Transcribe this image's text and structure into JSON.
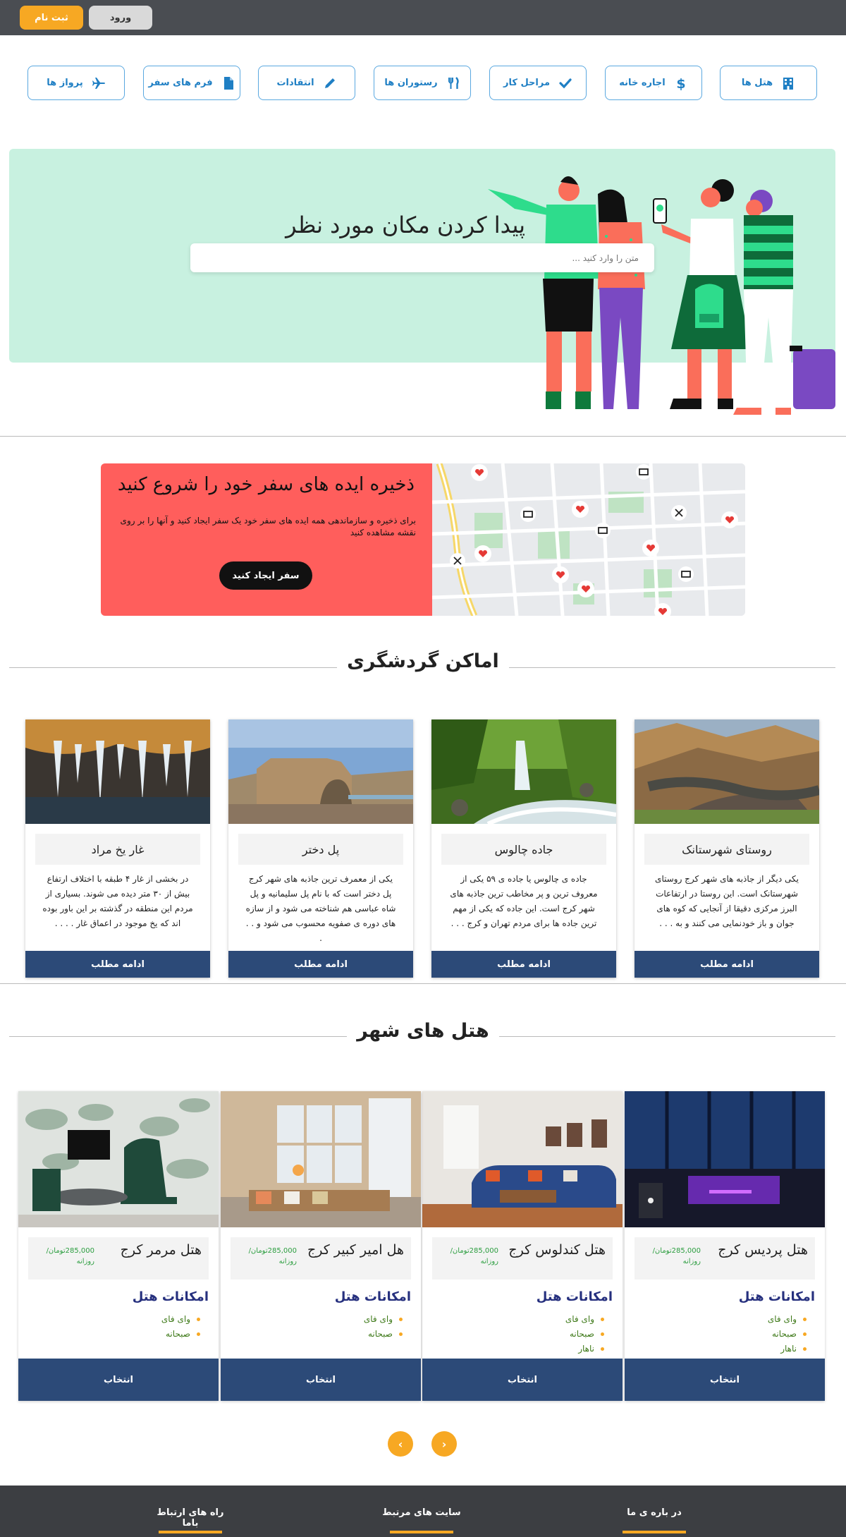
{
  "topbar": {
    "signup_label": "ثبت نام",
    "login_label": "ورود"
  },
  "categories": [
    {
      "label": "هتل ها",
      "icon": "building-icon"
    },
    {
      "label": "اجاره خانه",
      "icon": "dollar-icon"
    },
    {
      "label": "مراحل کار",
      "icon": "check-icon"
    },
    {
      "label": "رستوران ها",
      "icon": "utensils-icon"
    },
    {
      "label": "انتقادات",
      "icon": "pencil-icon"
    },
    {
      "label": "فرم های سفر",
      "icon": "file-icon"
    },
    {
      "label": "پرواز ها",
      "icon": "plane-icon"
    }
  ],
  "hero": {
    "title": "پیدا کردن مکان مورد نظر",
    "search_placeholder": "متن را وارد کنید ..."
  },
  "ideas": {
    "title": "ذخیره ایده های سفر خود را شروع کنید",
    "description": "برای ذخیره و سازماندهی همه ایده های سفر خود یک سفر ایجاد کنید و آنها را بر روی نقشه مشاهده کنید",
    "button_label": "سفر ایجاد کنید"
  },
  "places_section": {
    "title": "اماکن گردشگری"
  },
  "places": [
    {
      "name": "روستای شهرستانک",
      "description": "یکی دیگر از جاذبه های شهر کرج روستای شهرستانک است. این روستا در ارتفاعات البرز مرکزی دقیقا از آنجایی که کوه های جوان و باز خودنمایی می کنند و به . . .",
      "button_label": "ادامه مطلب"
    },
    {
      "name": "جاده چالوس",
      "description": "جاده ی چالوس یا جاده ی ۵۹ یکی از معروف ترین و پر مخاطب ترین جاذبه های شهر کرج است. این جاده که یکی از مهم ترین جاده ها برای مردم تهران و کرج . . .",
      "button_label": "ادامه مطلب"
    },
    {
      "name": "پل دختر",
      "description": "یکی از معمرف ترین جاذبه های شهر کرج پل دختر است که با نام پل سلیمانیه و پل شاه عباسی هم شناخته می شود و از سازه های دوره ی صفویه محسوب می شود و . . .",
      "button_label": "ادامه مطلب"
    },
    {
      "name": "غار یخ مراد",
      "description": "در بخشی از غار ۴ طبقه با اختلاف ارتفاع بیش از ۳۰ متر دیده می شوند. بسیاری از مردم این منطقه در گذشته بر این باور بوده اند که یخ موجود در اعماق غار . . . .",
      "button_label": "ادامه مطلب"
    }
  ],
  "hotels_section": {
    "title": "هتل های شهر"
  },
  "hotels": [
    {
      "name": "هتل پردیس کرج",
      "price": "285,000تومان/ روزانه",
      "facilities_title": "امکانات هتل",
      "facilities": [
        "وای فای",
        "صبحانه",
        "ناهار"
      ],
      "button_label": "انتخاب"
    },
    {
      "name": "هتل کندلوس کرج",
      "price": "285,000تومان/ روزانه",
      "facilities_title": "امکانات هتل",
      "facilities": [
        "وای فای",
        "صبحانه",
        "ناهار"
      ],
      "button_label": "انتخاب"
    },
    {
      "name": "هل امیر کبیر کرج",
      "price": "285,000تومان/ روزانه",
      "facilities_title": "امکانات هتل",
      "facilities": [
        "وای فای",
        "صبحانه"
      ],
      "button_label": "انتخاب"
    },
    {
      "name": "هتل مرمر کرج",
      "price": "285,000تومان/ روزانه",
      "facilities_title": "امکانات هتل",
      "facilities": [
        "وای فای",
        "صبحانه"
      ],
      "button_label": "انتخاب"
    }
  ],
  "carousel": {
    "prev": "‹",
    "next": "›"
  },
  "footer": {
    "about": "در باره ی ما",
    "related": "سایت های مرتبط",
    "contact": "راه های ارتباط باما"
  },
  "colors": {
    "accent": "#f7a823",
    "primary": "#2c4a78",
    "hero_bg": "#c8f1e0",
    "ideas_bg": "#ff5e5c",
    "topbar": "#4a4d52",
    "link_blue": "#1f7fc4"
  }
}
